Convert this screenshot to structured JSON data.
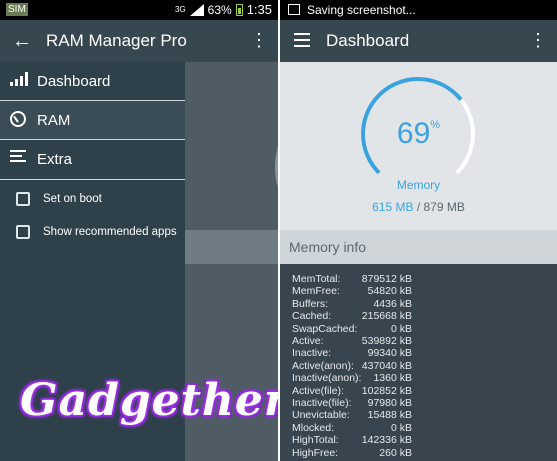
{
  "left_status": {
    "notification_icon": "sim-icon",
    "signal_label": "3G",
    "battery": "63%",
    "time": "1:35"
  },
  "left_app_bar": {
    "title": "RAM Manager Pro",
    "back_icon": "arrow-back-icon",
    "overflow_icon": "more-vert-icon"
  },
  "drawer": {
    "items": [
      {
        "label": "Dashboard",
        "icon": "bar-chart-icon"
      },
      {
        "label": "RAM",
        "icon": "gauge-icon"
      },
      {
        "label": "Extra",
        "icon": "list-icon"
      }
    ],
    "checks": [
      {
        "label": "Set on boot",
        "checked": false
      },
      {
        "label": "Show recommended apps",
        "checked": false
      }
    ]
  },
  "watermark": "Gadgethero",
  "right_status": {
    "notification_icon": "image-icon",
    "notification_text": "Saving screenshot..."
  },
  "right_app_bar": {
    "title": "Dashboard",
    "menu_icon": "hamburger-menu-icon",
    "overflow_icon": "more-vert-icon"
  },
  "memory_gauge": {
    "percent_value": "69",
    "percent_sign": "%",
    "fill_fraction": 0.69,
    "label": "Memory",
    "used": "615 MB",
    "separator": " / ",
    "total": "879 MB",
    "accent_color": "#3aa3df"
  },
  "memory_info": {
    "title": "Memory info",
    "rows": [
      {
        "key": "MemTotal:",
        "value": "879512 kB"
      },
      {
        "key": "MemFree:",
        "value": "54820 kB"
      },
      {
        "key": "Buffers:",
        "value": "4436 kB"
      },
      {
        "key": "Cached:",
        "value": "215668 kB"
      },
      {
        "key": "SwapCached:",
        "value": "0 kB"
      },
      {
        "key": "Active:",
        "value": "539892 kB"
      },
      {
        "key": "Inactive:",
        "value": "99340 kB"
      },
      {
        "key": "Active(anon):",
        "value": "437040 kB"
      },
      {
        "key": "Inactive(anon):",
        "value": "1360 kB"
      },
      {
        "key": "Active(file):",
        "value": "102852 kB"
      },
      {
        "key": "Inactive(file):",
        "value": "97980 kB"
      },
      {
        "key": "Unevictable:",
        "value": "15488 kB"
      },
      {
        "key": "Mlocked:",
        "value": "0 kB"
      },
      {
        "key": "HighTotal:",
        "value": "142336 kB"
      },
      {
        "key": "HighFree:",
        "value": "260 kB"
      }
    ]
  }
}
